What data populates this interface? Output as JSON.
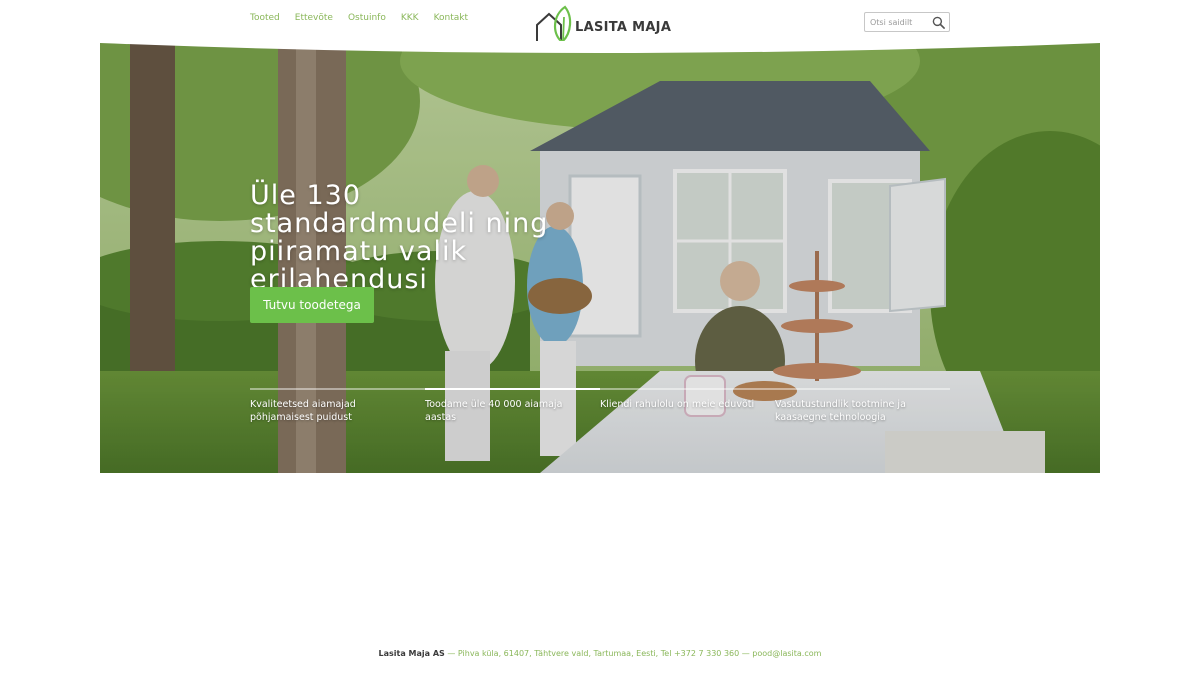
{
  "nav": {
    "items": [
      {
        "label": "Tooted"
      },
      {
        "label": "Ettevõte"
      },
      {
        "label": "Ostuinfo"
      },
      {
        "label": "KKK"
      },
      {
        "label": "Kontakt"
      }
    ]
  },
  "logo": {
    "text": "LASITA MAJA",
    "icon": "house-tree-logo",
    "color": "#6cc04a"
  },
  "search": {
    "placeholder": "Otsi saidilt",
    "icon": "search-icon"
  },
  "hero": {
    "title": "Üle 130 standardmudeli ning piiramatu valik erilahendusi",
    "button_label": "Tutvu toodetega",
    "button_color": "#6cc04a",
    "features": [
      {
        "text": "Kvaliteetsed aiamajad põhjamaisest puidust"
      },
      {
        "text": "Toodame üle 40 000 aiamaja aastas"
      },
      {
        "text": "Kliendi rahulolu on meie eduvõti"
      },
      {
        "text": "Vastutustundlik tootmine ja kaasaegne tehnoloogia"
      }
    ]
  },
  "footer": {
    "company": "Lasita Maja AS",
    "address": " — Pihva küla, 61407, Tähtvere vald, Tartumaa, Eesti, Tel +372 7 330 360 — ",
    "email": "pood@lasita.com"
  }
}
